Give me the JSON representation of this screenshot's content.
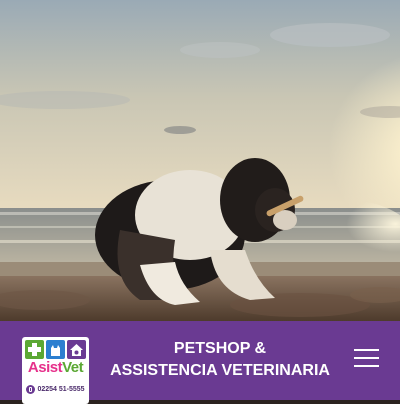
{
  "hero": {
    "image_alt": "",
    "scene": "puppy-on-beach-at-sunset"
  },
  "header": {
    "logo": {
      "name_part1": "Asist",
      "name_part2": "Vet",
      "phone": "02254 51-5555",
      "icons": [
        "medical-cross-icon",
        "cat-icon",
        "paw-house-icon"
      ],
      "colors": {
        "asist": "#e6318b",
        "vet": "#5ba834",
        "tile1": "#5ba834",
        "tile2": "#2c7fd0",
        "tile3": "#6a3a92"
      }
    },
    "title_line1": "PETSHOP &",
    "title_line2": "ASSISTENCIA VETERINARIA",
    "menu_icon": "hamburger-menu-icon"
  },
  "colors": {
    "bar_background": "#6a3a92",
    "title_text": "#ffffff"
  }
}
